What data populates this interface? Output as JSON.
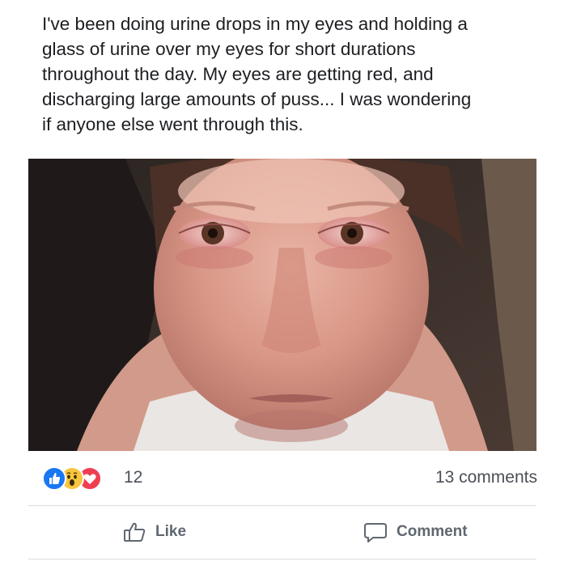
{
  "post": {
    "text_lines": [
      "I've been doing urine drops in my eyes and holding a",
      "glass of urine over my eyes for short durations",
      "throughout the day. My eyes are getting red, and",
      "discharging large amounts of puss... I was wondering",
      "if anyone else went through this."
    ]
  },
  "photo": {
    "subject": "close-up selfie of a woman's face with red irritated eyes"
  },
  "reactions": {
    "icons": [
      "like-icon",
      "wow-icon",
      "love-icon"
    ],
    "count": "12",
    "comments": "13 comments"
  },
  "actions": {
    "like_label": "Like",
    "comment_label": "Comment"
  },
  "colors": {
    "like_blue": "#1877f2",
    "wow_yellow": "#f7c53f",
    "love_red": "#ef3e52",
    "action_gray": "#606770"
  }
}
